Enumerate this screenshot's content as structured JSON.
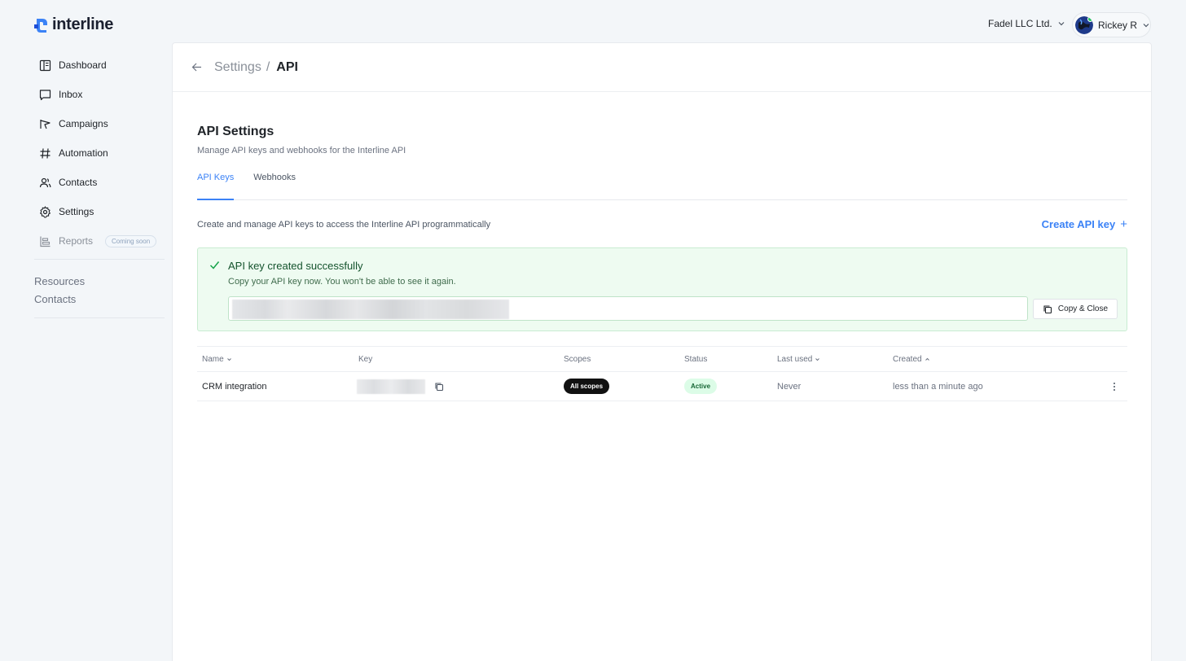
{
  "brand": {
    "name": "interline",
    "accent": "#3b82f6"
  },
  "header": {
    "org": "Fadel LLC Ltd.",
    "user": "Rickey R"
  },
  "sidebar": {
    "items": [
      {
        "label": "Dashboard",
        "icon": "dashboard-icon"
      },
      {
        "label": "Inbox",
        "icon": "inbox-icon"
      },
      {
        "label": "Campaigns",
        "icon": "campaigns-icon"
      },
      {
        "label": "Automation",
        "icon": "hash-icon"
      },
      {
        "label": "Contacts",
        "icon": "users-icon"
      },
      {
        "label": "Settings",
        "icon": "gear-icon"
      },
      {
        "label": "Reports",
        "icon": "chart-icon",
        "badge": "Coming soon"
      }
    ],
    "links": [
      "Resources",
      "Contacts"
    ]
  },
  "breadcrumb": {
    "parent": "Settings",
    "separator": "/",
    "current": "API"
  },
  "page": {
    "title": "API Settings",
    "subtitle": "Manage API keys and webhooks for the Interline API",
    "tabs": [
      "API Keys",
      "Webhooks"
    ],
    "description": "Create and manage API keys to access the Interline API programmatically",
    "create_label": "Create API key",
    "create_plus": "+"
  },
  "success": {
    "title": "API key created successfully",
    "message": "Copy your API key now. You won't be able to see it again.",
    "copy_close": "Copy & Close"
  },
  "table": {
    "headers": [
      "Name",
      "Key",
      "Scopes",
      "Status",
      "Last used",
      "Created"
    ],
    "rows": [
      {
        "name": "CRM integration",
        "scopes": "All scopes",
        "status": "Active",
        "last_used": "Never",
        "created": "less than a minute ago"
      }
    ]
  }
}
